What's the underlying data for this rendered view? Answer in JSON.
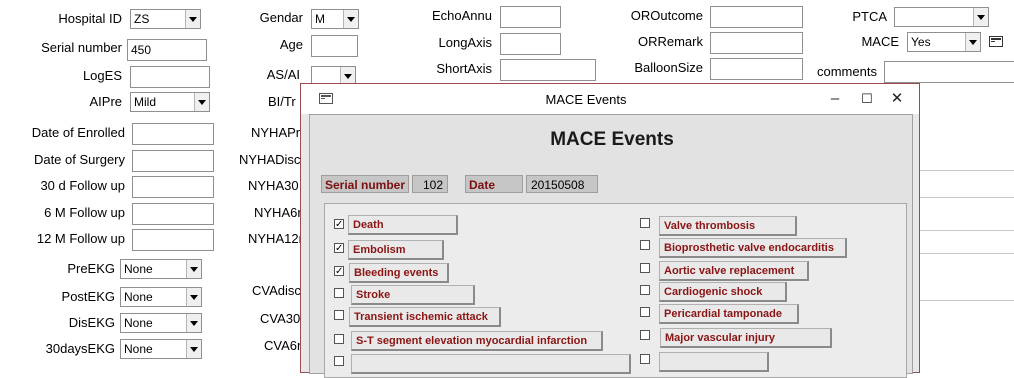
{
  "form": {
    "hospital_id": {
      "label": "Hospital ID",
      "value": "ZS"
    },
    "serial_number": {
      "label": "Serial number",
      "value": "450"
    },
    "loges": {
      "label": "LogES",
      "value": ""
    },
    "aipre": {
      "label": "AIPre",
      "value": "Mild"
    },
    "date_enrolled": {
      "label": "Date of Enrolled",
      "value": ""
    },
    "date_surgery": {
      "label": "Date of Surgery",
      "value": ""
    },
    "followup_30d": {
      "label": "30 d Follow up",
      "value": ""
    },
    "followup_6m": {
      "label": "6 M Follow up",
      "value": ""
    },
    "followup_12m": {
      "label": "12 M Follow up",
      "value": ""
    },
    "preekg": {
      "label": "PreEKG",
      "value": "None"
    },
    "postekg": {
      "label": "PostEKG",
      "value": "None"
    },
    "disekg": {
      "label": "DisEKG",
      "value": "None"
    },
    "days30ekg": {
      "label": "30daysEKG",
      "value": "None"
    },
    "gender": {
      "label": "Gendar",
      "value": "M"
    },
    "age": {
      "label": "Age",
      "value": ""
    },
    "as_ai": {
      "label": "AS/AI",
      "value": ""
    },
    "bi_tr": {
      "label": "BI/Tr"
    },
    "nyhapre": {
      "label": "NYHAPr"
    },
    "nyhadisc": {
      "label": "NYHADisc"
    },
    "nyha30": {
      "label": "NYHA30"
    },
    "nyha6": {
      "label": "NYHA6r"
    },
    "nyha12": {
      "label": "NYHA12r"
    },
    "cvadisc": {
      "label": "CVAdisc"
    },
    "cva30": {
      "label": "CVA30"
    },
    "cva6": {
      "label": "CVA6r"
    },
    "echoannu": {
      "label": "EchoAnnu",
      "value": ""
    },
    "longaxis": {
      "label": "LongAxis",
      "value": ""
    },
    "shortaxis": {
      "label": "ShortAxis",
      "value": ""
    },
    "oroutcome": {
      "label": "OROutcome",
      "value": ""
    },
    "orremark": {
      "label": "ORRemark",
      "value": ""
    },
    "balloonsize": {
      "label": "BalloonSize",
      "value": ""
    },
    "ptca": {
      "label": "PTCA",
      "value": ""
    },
    "mace": {
      "label": "MACE",
      "value": "Yes"
    },
    "comments": {
      "label": "comments",
      "value": ""
    }
  },
  "popup": {
    "window_title": "MACE Events",
    "heading": "MACE Events",
    "serial_label": "Serial number",
    "serial_value": "102",
    "date_label": "Date",
    "date_value": "20150508",
    "controls": {
      "minimize": "–",
      "maximize": "☐",
      "close": "✕"
    },
    "events_left": [
      {
        "label": "Death",
        "checked": true
      },
      {
        "label": "Embolism",
        "checked": true
      },
      {
        "label": "Bleeding events",
        "checked": true
      },
      {
        "label": "Stroke",
        "checked": false
      },
      {
        "label": "Transient ischemic attack",
        "checked": false
      },
      {
        "label": "S-T segment elevation myocardial infarction",
        "checked": false
      }
    ],
    "events_right": [
      {
        "label": "Valve thrombosis",
        "checked": false
      },
      {
        "label": "Bioprosthetic valve endocarditis",
        "checked": false
      },
      {
        "label": "Aortic valve replacement",
        "checked": false
      },
      {
        "label": "Cardiogenic shock",
        "checked": false
      },
      {
        "label": "Pericardial tamponade",
        "checked": false
      },
      {
        "label": "Major vascular injury",
        "checked": false
      }
    ]
  },
  "colors": {
    "event_text": "#8b1414",
    "popup_border": "#9a4b4b"
  }
}
